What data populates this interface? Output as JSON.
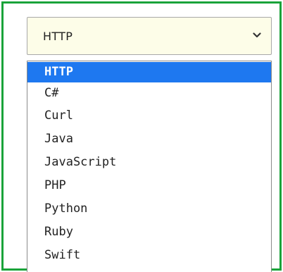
{
  "select": {
    "value": "HTTP",
    "chevron_icon": "chevron-down-icon",
    "options": [
      "HTTP",
      "C#",
      "Curl",
      "Java",
      "JavaScript",
      "PHP",
      "Python",
      "Ruby",
      "Swift"
    ],
    "selected_option": "HTTP"
  },
  "colors": {
    "frame_border": "#1aa33a",
    "selected_background": "#1e78f0",
    "select_background": "#fdfde8"
  }
}
